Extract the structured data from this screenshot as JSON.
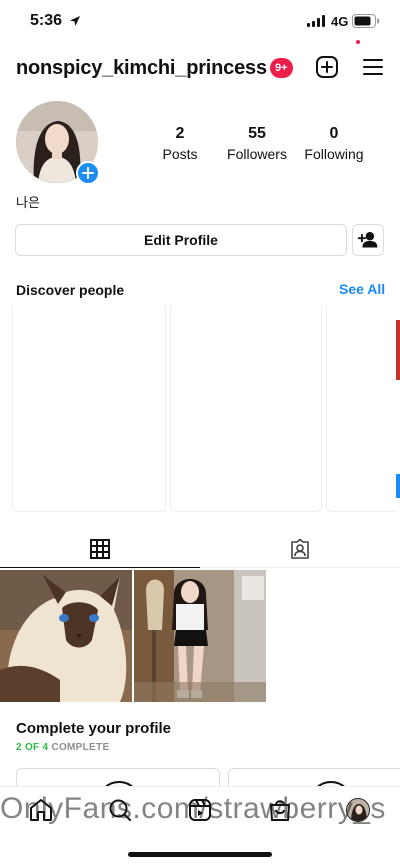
{
  "status_bar": {
    "time": "5:36",
    "network": "4G"
  },
  "header": {
    "username": "nonspicy_kimchi_princess",
    "notification_count": "9+"
  },
  "profile": {
    "stats": [
      {
        "value": "2",
        "label": "Posts"
      },
      {
        "value": "55",
        "label": "Followers"
      },
      {
        "value": "0",
        "label": "Following"
      }
    ],
    "bio": "나은",
    "edit_profile_label": "Edit Profile"
  },
  "discover": {
    "title": "Discover people",
    "see_all": "See All"
  },
  "complete_profile": {
    "title": "Complete your profile",
    "progress": "2 OF 4",
    "progress_suffix": " COMPLETE"
  },
  "watermark": "OnlyFans.com/strawberry_s",
  "colors": {
    "accent_blue": "#1a8cf3",
    "badge_red": "#ed1c4a",
    "progress_green": "#2cb844"
  },
  "icons": [
    "location-arrow-icon",
    "signal-icon",
    "battery-icon",
    "plus-square-icon",
    "menu-icon",
    "add-person-icon",
    "grid-icon",
    "tagged-icon",
    "home-icon",
    "search-icon",
    "reels-icon",
    "shop-icon"
  ]
}
